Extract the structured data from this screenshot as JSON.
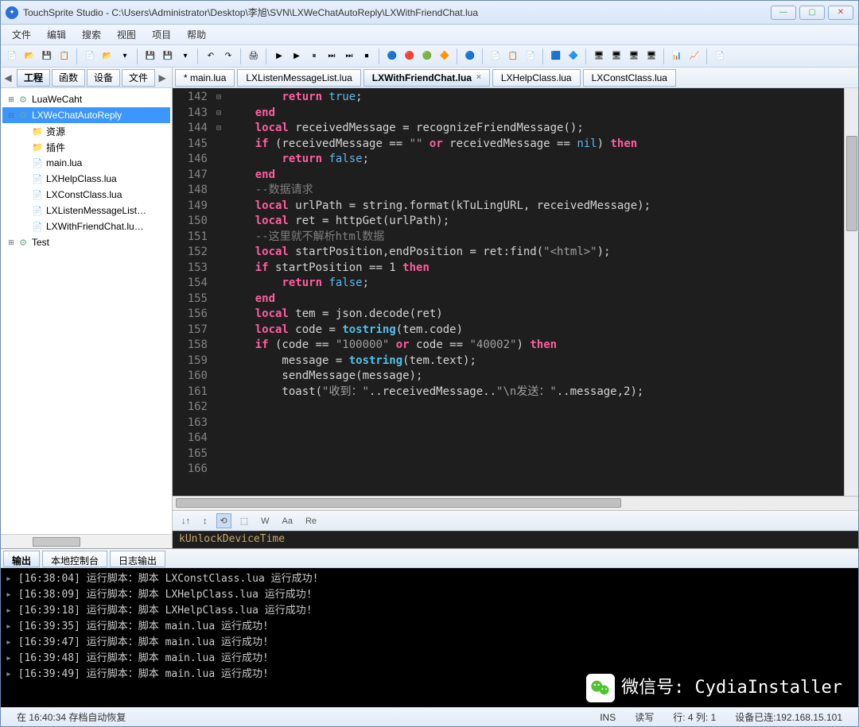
{
  "window": {
    "title": "TouchSprite Studio - C:\\Users\\Administrator\\Desktop\\李旭\\SVN\\LXWeChatAutoReply\\LXWithFriendChat.lua"
  },
  "menu": [
    "文件",
    "编辑",
    "搜索",
    "视图",
    "项目",
    "帮助"
  ],
  "side": {
    "tabs": [
      "工程",
      "函数",
      "设备",
      "文件"
    ],
    "active": 0,
    "tree": [
      {
        "d": 0,
        "exp": "+",
        "icon": "gear",
        "label": "LuaWeCaht"
      },
      {
        "d": 0,
        "exp": "-",
        "icon": "gear",
        "label": "LXWeChatAutoReply",
        "sel": true
      },
      {
        "d": 1,
        "exp": "",
        "icon": "folder",
        "label": "资源"
      },
      {
        "d": 1,
        "exp": "",
        "icon": "folder",
        "label": "插件"
      },
      {
        "d": 1,
        "exp": "",
        "icon": "lua",
        "label": "main.lua"
      },
      {
        "d": 1,
        "exp": "",
        "icon": "lua",
        "label": "LXHelpClass.lua"
      },
      {
        "d": 1,
        "exp": "",
        "icon": "lua",
        "label": "LXConstClass.lua"
      },
      {
        "d": 1,
        "exp": "",
        "icon": "lua",
        "label": "LXListenMessageList…"
      },
      {
        "d": 1,
        "exp": "",
        "icon": "lua",
        "label": "LXWithFriendChat.lu…"
      },
      {
        "d": 0,
        "exp": "+",
        "icon": "gear",
        "label": "Test"
      }
    ]
  },
  "editorTabs": [
    {
      "label": "* main.lua"
    },
    {
      "label": "LXListenMessageList.lua"
    },
    {
      "label": "LXWithFriendChat.lua",
      "active": true,
      "close": true
    },
    {
      "label": "LXHelpClass.lua"
    },
    {
      "label": "LXConstClass.lua"
    }
  ],
  "lines": [
    {
      "n": 142,
      "h": "        <kw>return</kw> <bool>true</bool>;"
    },
    {
      "n": 143,
      "h": "    <kw>end</kw>"
    },
    {
      "n": 144,
      "h": ""
    },
    {
      "n": 145,
      "h": "    <kw>local</kw> receivedMessage = recognizeFriendMessage();"
    },
    {
      "n": 146,
      "fold": "-",
      "h": "    <kw>if</kw> (receivedMessage == <str>\"\"</str> <kw>or</kw> receivedMessage == <bool>nil</bool>) <kw>then</kw>"
    },
    {
      "n": 147,
      "h": "        <kw>return</kw> <bool>false</bool>;"
    },
    {
      "n": 148,
      "h": "    <kw>end</kw>"
    },
    {
      "n": 149,
      "h": ""
    },
    {
      "n": 150,
      "h": "    <cmt>--数据请求</cmt>"
    },
    {
      "n": 151,
      "h": "    <kw>local</kw> urlPath = string.format(kTuLingURL, receivedMessage);"
    },
    {
      "n": 152,
      "h": "    <kw>local</kw> ret = httpGet(urlPath);"
    },
    {
      "n": 153,
      "h": ""
    },
    {
      "n": 154,
      "h": "    <cmt>--这里就不解析html数据</cmt>"
    },
    {
      "n": 155,
      "h": "    <kw>local</kw> startPosition,endPosition = ret:find(<str>\"&lt;html&gt;\"</str>);"
    },
    {
      "n": 156,
      "fold": "-",
      "h": "    <kw>if</kw> startPosition == 1 <kw>then</kw>"
    },
    {
      "n": 157,
      "h": "        <kw>return</kw> <bool>false</bool>;"
    },
    {
      "n": 158,
      "h": "    <kw>end</kw>"
    },
    {
      "n": 159,
      "h": ""
    },
    {
      "n": 160,
      "h": "    <kw>local</kw> tem = json.decode(ret)"
    },
    {
      "n": 161,
      "h": "    <kw>local</kw> code = <kw2>tostring</kw2>(tem.code)"
    },
    {
      "n": 162,
      "fold": "-",
      "h": "    <kw>if</kw> (code == <str>\"100000\"</str> <kw>or</kw> code == <str>\"40002\"</str>) <kw>then</kw>"
    },
    {
      "n": 163,
      "h": "        message = <kw2>tostring</kw2>(tem.text);"
    },
    {
      "n": 164,
      "h": "        sendMessage(message);"
    },
    {
      "n": 165,
      "h": ""
    },
    {
      "n": 166,
      "h": "        toast(<str>\"收到：\"</str>..receivedMessage..<str>\"\\n发送：\"</str>..message,2);"
    }
  ],
  "findbar": {
    "opts": [
      "↓↑",
      "↕",
      "⟲",
      "⬚",
      "W",
      "Aa",
      "Re"
    ],
    "symbol": "kUnlockDeviceTime"
  },
  "bottom": {
    "tabs": [
      "输出",
      "本地控制台",
      "日志输出"
    ],
    "active": 0,
    "lines": [
      "[16:38:04] 运行脚本：脚本 LXConstClass.lua 运行成功!",
      "[16:38:09] 运行脚本：脚本 LXHelpClass.lua 运行成功!",
      "[16:39:18] 运行脚本：脚本 LXHelpClass.lua 运行成功!",
      "[16:39:35] 运行脚本：脚本 main.lua 运行成功!",
      "[16:39:47] 运行脚本：脚本 main.lua 运行成功!",
      "[16:39:48] 运行脚本：脚本 main.lua 运行成功!",
      "[16:39:49] 运行脚本：脚本 main.lua 运行成功!"
    ]
  },
  "watermark": {
    "label": "微信号: CydiaInstaller"
  },
  "status": {
    "left": "在 16:40:34 存档自动恢复",
    "ins": "INS",
    "rw": "读写",
    "pos": "行: 4 列: 1",
    "dev": "设备已连:192.168.15.101"
  }
}
